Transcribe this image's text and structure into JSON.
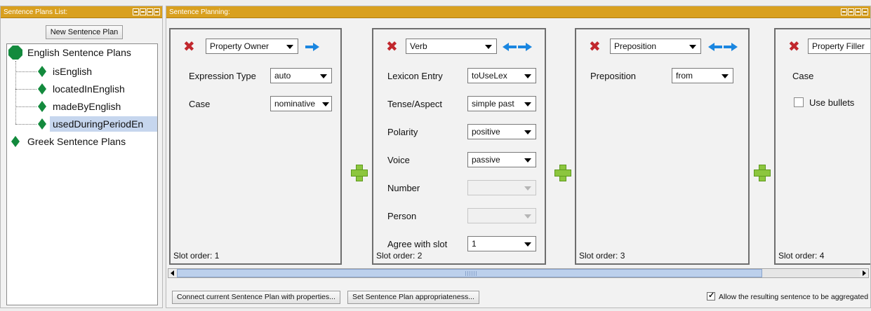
{
  "left_panel": {
    "title": "Sentence Plans List:",
    "new_button": "New Sentence Plan",
    "tree": {
      "english_root": "English Sentence Plans",
      "english_children": [
        "isEnglish",
        "locatedInEnglish",
        "madeByEnglish",
        "usedDuringPeriodEn"
      ],
      "greek_root": "Greek Sentence Plans"
    }
  },
  "right_panel": {
    "title": "Sentence Planning:",
    "slots": [
      {
        "type": "Property Owner",
        "fields": [
          {
            "label": "Expression Type",
            "value": "auto"
          },
          {
            "label": "Case",
            "value": "nominative"
          }
        ],
        "order": "Slot order: 1"
      },
      {
        "type": "Verb",
        "fields": [
          {
            "label": "Lexicon Entry",
            "value": "toUseLex"
          },
          {
            "label": "Tense/Aspect",
            "value": "simple past"
          },
          {
            "label": "Polarity",
            "value": "positive"
          },
          {
            "label": "Voice",
            "value": "passive"
          },
          {
            "label": "Number",
            "value": ""
          },
          {
            "label": "Person",
            "value": ""
          },
          {
            "label": "Agree with slot",
            "value": "1"
          }
        ],
        "order": "Slot order: 2"
      },
      {
        "type": "Preposition",
        "fields": [
          {
            "label": "Preposition",
            "value": "from"
          }
        ],
        "order": "Slot order: 3"
      },
      {
        "type": "Property Filler",
        "fields": [
          {
            "label": "Case",
            "value": ""
          }
        ],
        "checkbox_label": "Use bullets",
        "order": "Slot order: 4"
      }
    ],
    "buttons": {
      "connect": "Connect current Sentence Plan with properties...",
      "appropriateness": "Set Sentence Plan appropriateness..."
    },
    "aggregate_label": "Allow the resulting sentence to be aggregated",
    "aggregate_checked": true
  }
}
